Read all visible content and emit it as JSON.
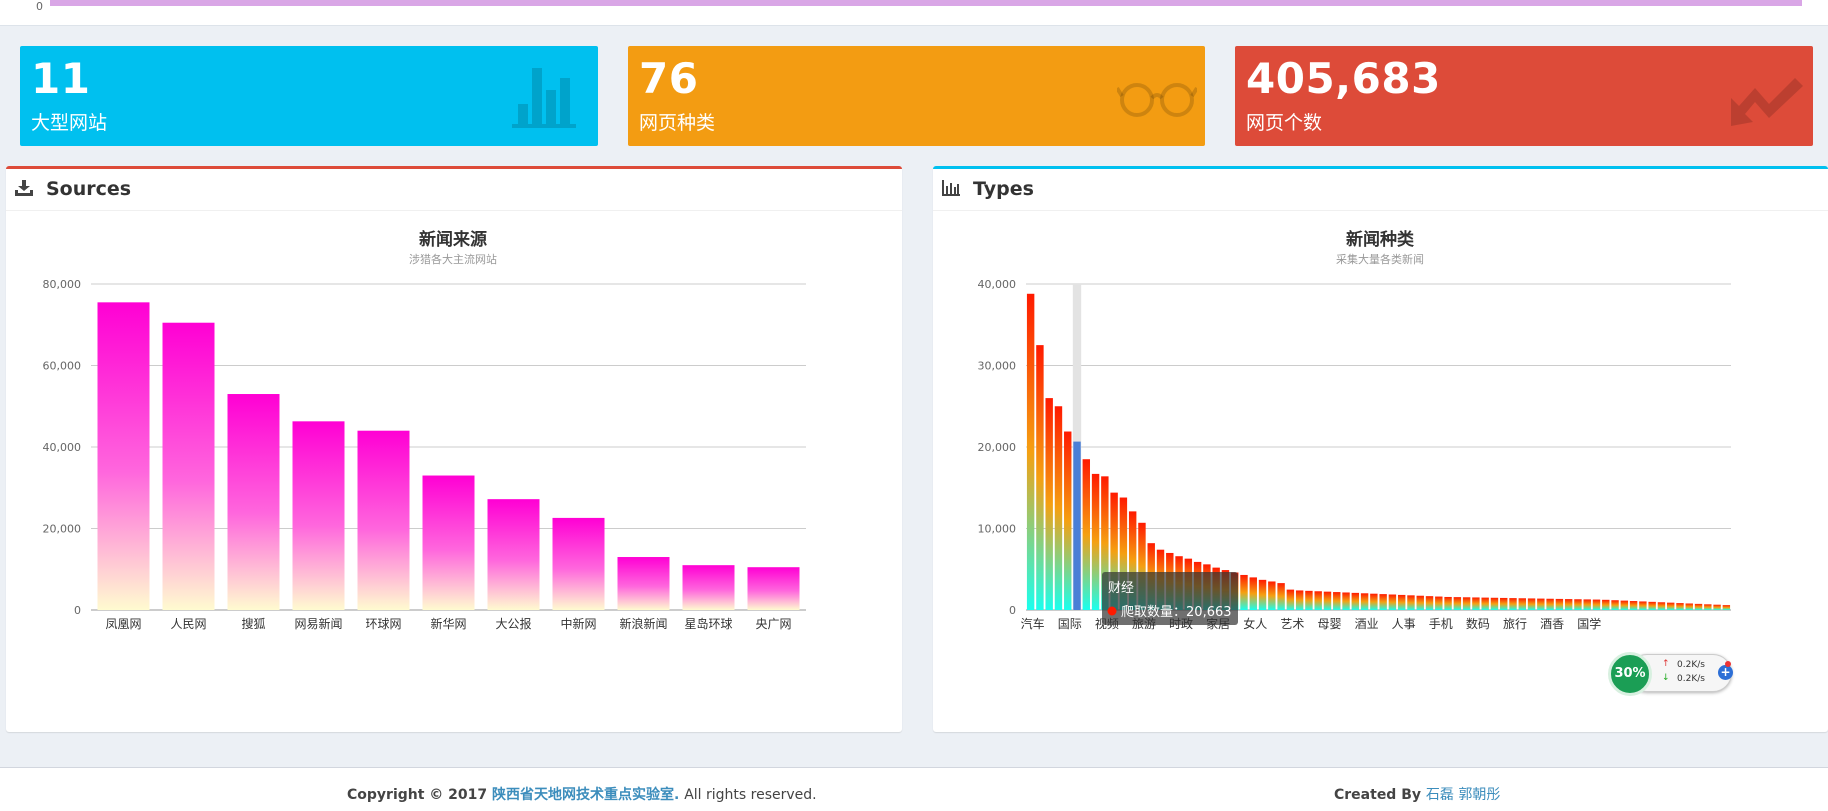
{
  "top_strip": {
    "zero_label": "0",
    "bar_color": "#d9a6e6"
  },
  "stats": [
    {
      "value": "11",
      "label": "大型网站",
      "icon": "bar-chart-icon",
      "color": "#00c0ef"
    },
    {
      "value": "76",
      "label": "网页种类",
      "icon": "glasses-icon",
      "color": "#f39c12"
    },
    {
      "value": "405,683",
      "label": "网页个数",
      "icon": "trend-down-icon",
      "color": "#dd4b39"
    }
  ],
  "boxes": {
    "sources": {
      "title": "Sources",
      "icon": "download-icon",
      "border_color": "#dd4b39"
    },
    "types": {
      "title": "Types",
      "icon": "bar-chart-icon",
      "border_color": "#00c0ef"
    }
  },
  "chart_data": [
    {
      "type": "bar",
      "title": "新闻来源",
      "subtitle": "涉猎各大主流网站",
      "categories": [
        "凤凰网",
        "人民网",
        "搜狐",
        "网易新闻",
        "环球网",
        "新华网",
        "大公报",
        "中新网",
        "新浪新闻",
        "星岛环球",
        "央广网"
      ],
      "values": [
        75500,
        70500,
        53000,
        46300,
        44000,
        33000,
        27200,
        22600,
        13000,
        11000,
        10500
      ],
      "ylim": [
        0,
        80000
      ],
      "yticks": [
        "0",
        "20,000",
        "40,000",
        "60,000",
        "80,000"
      ],
      "grid": true,
      "colors": {
        "top": "#ff00d4",
        "bottom": "#fffbd0"
      }
    },
    {
      "type": "bar",
      "title": "新闻种类",
      "subtitle": "采集大量各类新闻",
      "categories": [
        "汽车",
        "国际",
        "视频",
        "旅游",
        "时政",
        "家居",
        "女人",
        "艺术",
        "母婴",
        "酒业",
        "人事",
        "手机",
        "数码",
        "旅行",
        "酒香",
        "国学"
      ],
      "values": [
        38800,
        32500,
        26000,
        25000,
        21900,
        20663,
        18500,
        16700,
        16400,
        14400,
        13800,
        12100,
        10700,
        8200,
        7400,
        7000,
        6600,
        6300,
        5900,
        5600,
        5200,
        4900,
        4600,
        4300,
        4000,
        3700,
        3500,
        3300,
        2500,
        2400,
        2350,
        2300,
        2250,
        2200,
        2150,
        2100,
        2050,
        2000,
        1950,
        1900,
        1850,
        1800,
        1750,
        1700,
        1650,
        1600,
        1580,
        1560,
        1540,
        1520,
        1500,
        1480,
        1460,
        1440,
        1420,
        1400,
        1380,
        1360,
        1340,
        1320,
        1300,
        1280,
        1250,
        1200,
        1150,
        1100,
        1050,
        1000,
        950,
        900,
        850,
        800,
        750,
        700,
        650,
        600
      ],
      "highlight_index": 5,
      "ylim": [
        0,
        40000
      ],
      "yticks": [
        "0",
        "10,000",
        "20,000",
        "30,000",
        "40,000"
      ],
      "grid": true,
      "tooltip": {
        "category": "财经",
        "series_label": "爬取数量",
        "value": "20,663"
      },
      "colors": {
        "top": "#ff1a00",
        "mid": "#f5a011",
        "bottom": "#1affee",
        "highlight": "#4a7fd6"
      }
    }
  ],
  "footer": {
    "copyright_prefix": "Copyright © 2017",
    "lab_link": "陕西省天地网技术重点实验室.",
    "rights": "All rights reserved.",
    "created_prefix": "Created By",
    "authors": "石磊 郭朝彤"
  },
  "speed_widget": {
    "percent": "30%",
    "up": "0.2K/s",
    "down": "0.2K/s"
  }
}
